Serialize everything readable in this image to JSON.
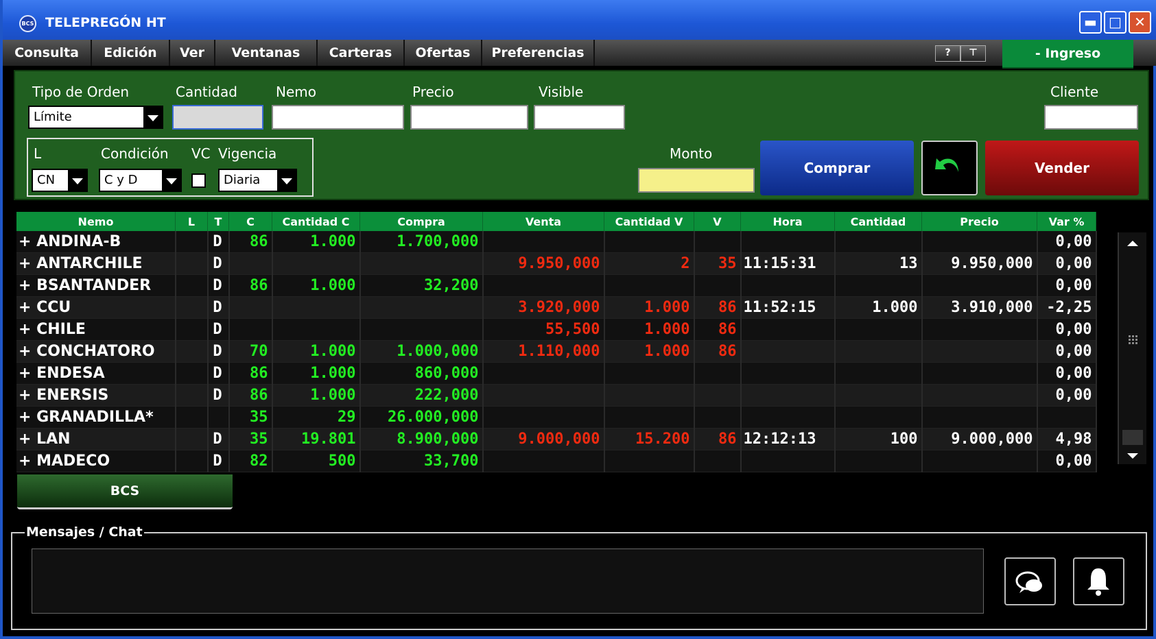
{
  "window": {
    "logo_text": "BCS",
    "title": "TELEPREGÓN HT"
  },
  "window_buttons": {
    "minimize": "▬",
    "maximize": "□",
    "close": "✕"
  },
  "menu": [
    "Consulta",
    "Edición",
    "Ver",
    "Ventanas",
    "Carteras",
    "Ofertas",
    "Preferencias"
  ],
  "toolbar": {
    "help": "?",
    "pin": "⊤",
    "login_label": "- Ingreso"
  },
  "order": {
    "tipo_label": "Tipo de Orden",
    "tipo_value": "Límite",
    "cantidad_label": "Cantidad",
    "nemo_label": "Nemo",
    "precio_label": "Precio",
    "visible_label": "Visible",
    "cliente_label": "Cliente",
    "l_label": "L",
    "l_value": "CN",
    "condicion_label": "Condición",
    "condicion_value": "C y D",
    "vc_label": "VC",
    "vigencia_label": "Vigencia",
    "vigencia_value": "Diaria",
    "monto_label": "Monto",
    "comprar_label": "Comprar",
    "vender_label": "Vender",
    "comprar_color": "#13389a",
    "vender_color": "#9b1010"
  },
  "table": {
    "headers": [
      "Nemo",
      "L",
      "T",
      "C",
      "Cantidad C",
      "Compra",
      "Venta",
      "Cantidad V",
      "V",
      "Hora",
      "Cantidad",
      "Precio",
      "Var %"
    ],
    "rows": [
      {
        "nemo": "+ ANDINA-B",
        "l": "",
        "t": "D",
        "c": "86",
        "cant_c": "1.000",
        "compra": "1.700,000",
        "venta": "",
        "cant_v": "",
        "v": "",
        "hora": "",
        "cantidad": "",
        "precio": "",
        "var": "0,00"
      },
      {
        "nemo": "+ ANTARCHILE",
        "l": "",
        "t": "D",
        "c": "",
        "cant_c": "",
        "compra": "",
        "venta": "9.950,000",
        "cant_v": "2",
        "v": "35",
        "hora": "11:15:31",
        "cantidad": "13",
        "precio": "9.950,000",
        "var": "0,00"
      },
      {
        "nemo": "+ BSANTANDER",
        "l": "",
        "t": "D",
        "c": "86",
        "cant_c": "1.000",
        "compra": "32,200",
        "venta": "",
        "cant_v": "",
        "v": "",
        "hora": "",
        "cantidad": "",
        "precio": "",
        "var": "0,00"
      },
      {
        "nemo": "+ CCU",
        "l": "",
        "t": "D",
        "c": "",
        "cant_c": "",
        "compra": "",
        "venta": "3.920,000",
        "cant_v": "1.000",
        "v": "86",
        "hora": "11:52:15",
        "cantidad": "1.000",
        "precio": "3.910,000",
        "var": "-2,25"
      },
      {
        "nemo": "+ CHILE",
        "l": "",
        "t": "D",
        "c": "",
        "cant_c": "",
        "compra": "",
        "venta": "55,500",
        "cant_v": "1.000",
        "v": "86",
        "hora": "",
        "cantidad": "",
        "precio": "",
        "var": "0,00"
      },
      {
        "nemo": "+ CONCHATORO",
        "l": "",
        "t": "D",
        "c": "70",
        "cant_c": "1.000",
        "compra": "1.000,000",
        "venta": "1.110,000",
        "cant_v": "1.000",
        "v": "86",
        "hora": "",
        "cantidad": "",
        "precio": "",
        "var": "0,00"
      },
      {
        "nemo": "+ ENDESA",
        "l": "",
        "t": "D",
        "c": "86",
        "cant_c": "1.000",
        "compra": "860,000",
        "venta": "",
        "cant_v": "",
        "v": "",
        "hora": "",
        "cantidad": "",
        "precio": "",
        "var": "0,00"
      },
      {
        "nemo": "+ ENERSIS",
        "l": "",
        "t": "D",
        "c": "86",
        "cant_c": "1.000",
        "compra": "222,000",
        "venta": "",
        "cant_v": "",
        "v": "",
        "hora": "",
        "cantidad": "",
        "precio": "",
        "var": "0,00"
      },
      {
        "nemo": "+ GRANADILLA*",
        "l": "",
        "t": "",
        "c": "35",
        "cant_c": "29",
        "compra": "26.000,000",
        "venta": "",
        "cant_v": "",
        "v": "",
        "hora": "",
        "cantidad": "",
        "precio": "",
        "var": ""
      },
      {
        "nemo": "+ LAN",
        "l": "",
        "t": "D",
        "c": "35",
        "cant_c": "19.801",
        "compra": "8.900,000",
        "venta": "9.000,000",
        "cant_v": "15.200",
        "v": "86",
        "hora": "12:12:13",
        "cantidad": "100",
        "precio": "9.000,000",
        "var": "4,98"
      },
      {
        "nemo": "+ MADECO",
        "l": "",
        "t": "D",
        "c": "82",
        "cant_c": "500",
        "compra": "33,700",
        "venta": "",
        "cant_v": "",
        "v": "",
        "hora": "",
        "cantidad": "",
        "precio": "",
        "var": "0,00"
      }
    ]
  },
  "tabs": {
    "bcs": "BCS"
  },
  "messages": {
    "label": "Mensajes / Chat"
  }
}
